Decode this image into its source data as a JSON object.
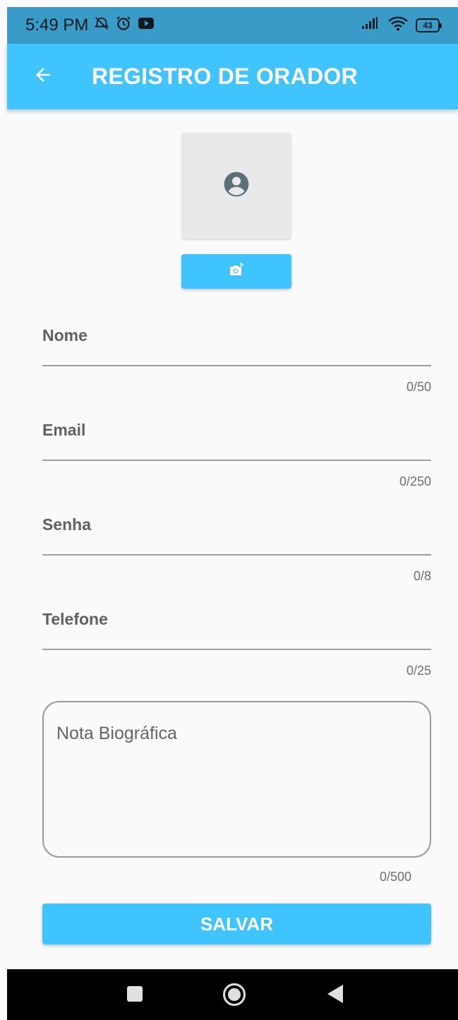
{
  "status_bar": {
    "time": "5:49 PM",
    "battery_level": "43",
    "icons": [
      "alarm-off-icon",
      "alarm-icon",
      "youtube-icon",
      "signal-icon",
      "wifi-icon",
      "battery-icon"
    ]
  },
  "app_bar": {
    "title": "REGISTRO DE ORADOR",
    "back_icon": "arrow-back-icon",
    "color": "#40c4ff"
  },
  "profile": {
    "avatar_icon": "account-circle-icon",
    "photo_button_icon": "camera-icon"
  },
  "form": {
    "fields": [
      {
        "label": "Nome",
        "value": "",
        "counter": "0/50"
      },
      {
        "label": "Email",
        "value": "",
        "counter": "0/250"
      },
      {
        "label": "Senha",
        "value": "",
        "counter": "0/8"
      },
      {
        "label": "Telefone",
        "value": "",
        "counter": "0/25"
      }
    ],
    "bio": {
      "placeholder": "Nota Biográfica",
      "counter": "0/500"
    },
    "save_label": "SALVAR"
  },
  "nav_bar": {
    "icons": [
      "recents-icon",
      "home-icon",
      "back-icon"
    ]
  },
  "colors": {
    "accent": "#40c4ff",
    "status_bar": "#3a9cc6",
    "background": "#fafafa"
  }
}
